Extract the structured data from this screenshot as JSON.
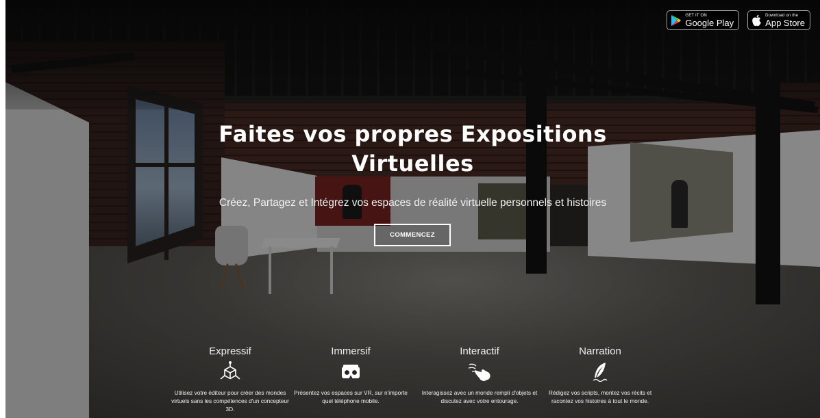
{
  "store_badges": {
    "google_play": {
      "top_text": "GET IT ON",
      "main_text": "Google Play",
      "icon": "google-play-icon"
    },
    "app_store": {
      "top_text": "Download on the",
      "main_text": "App Store",
      "icon": "apple-icon"
    }
  },
  "hero": {
    "title_line1": "Faites vos propres Expositions",
    "title_line2": "Virtuelles",
    "subtitle": "Créez, Partagez et Intégrez vos espaces de réalité virtuelle personnels et histoires",
    "cta_label": "COMMENCEZ"
  },
  "features": [
    {
      "title": "Expressif",
      "icon": "cube-axes-icon",
      "description": "Utilisez votre éditeur pour créer des mondes virtuels sans les compétences d'un concepteur 3D."
    },
    {
      "title": "Immersif",
      "icon": "vr-headset-icon",
      "description": "Présentez vos espaces sur VR, sur n'importe quel téléphone mobile."
    },
    {
      "title": "Interactif",
      "icon": "touch-hand-icon",
      "description": "Interagissez avec un monde rempli d'objets et discutez avec votre entourage."
    },
    {
      "title": "Narration",
      "icon": "quill-icon",
      "description": "Rédigez vos scripts, montez vos récits et racontez vos histoires à tout le monde."
    }
  ]
}
